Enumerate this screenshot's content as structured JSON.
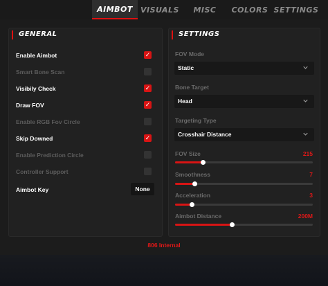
{
  "tabs": [
    {
      "label": "AIMBOT",
      "active": true
    },
    {
      "label": "VISUALS",
      "active": false
    },
    {
      "label": "MISC",
      "active": false
    },
    {
      "label": "COLORS",
      "active": false
    },
    {
      "label": "SETTINGS",
      "active": false
    }
  ],
  "general": {
    "title": "GENERAL",
    "options": [
      {
        "label": "Enable Aimbot",
        "checked": true,
        "enabled": true
      },
      {
        "label": "Smart Bone Scan",
        "checked": false,
        "enabled": false
      },
      {
        "label": "Visibily Check",
        "checked": true,
        "enabled": true
      },
      {
        "label": "Draw FOV",
        "checked": true,
        "enabled": true
      },
      {
        "label": "Enable RGB Fov Circle",
        "checked": false,
        "enabled": false
      },
      {
        "label": "Skip Downed",
        "checked": true,
        "enabled": true
      },
      {
        "label": "Enable Prediction Circle",
        "checked": false,
        "enabled": false
      },
      {
        "label": "Controller Support",
        "checked": false,
        "enabled": false
      }
    ],
    "aimbot_key": {
      "label": "Aimbot Key",
      "value": "None"
    }
  },
  "settings": {
    "title": "SETTINGS",
    "selects": [
      {
        "label": "FOV Mode",
        "value": "Static"
      },
      {
        "label": "Bone Target",
        "value": "Head"
      },
      {
        "label": "Targeting Type",
        "value": "Crosshair  Distance"
      }
    ],
    "sliders": [
      {
        "label": "FOV Size",
        "value": "215",
        "fraction": 0.2
      },
      {
        "label": "Smoothness",
        "value": "7",
        "fraction": 0.14
      },
      {
        "label": "Acceleration",
        "value": "3",
        "fraction": 0.12
      },
      {
        "label": "Aimbot Distance",
        "value": "200M",
        "fraction": 0.41
      }
    ]
  },
  "footer": {
    "text": "806 Internal"
  },
  "colors": {
    "accent": "#e01010",
    "checked": "#d81414",
    "background": "#1c1c1c",
    "panel": "#212121"
  }
}
